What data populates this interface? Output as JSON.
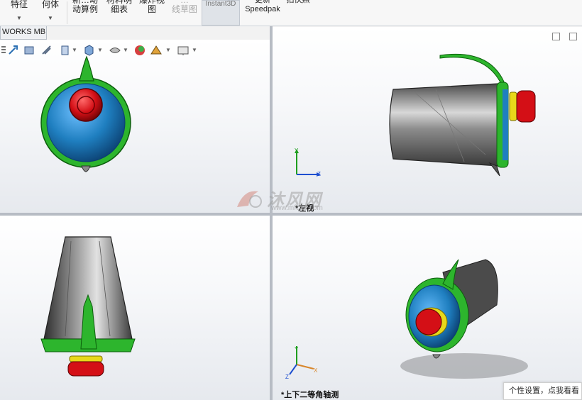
{
  "ribbon": {
    "buttons": [
      {
        "label": "特征",
        "has_arrow": true
      },
      {
        "label": "何体",
        "has_arrow": true
      },
      {
        "label": "新…动\n动算例",
        "has_arrow": false
      },
      {
        "label": "材料明\n细表",
        "has_arrow": false
      },
      {
        "label": "爆炸视\n图",
        "has_arrow": false
      },
      {
        "label": "…\n线草图",
        "has_arrow": false,
        "disabled": true
      },
      {
        "label": "Instant3D",
        "has_arrow": false,
        "active": true
      },
      {
        "label": "更新\nSpeedpak",
        "has_arrow": false
      },
      {
        "label": "拍快照",
        "has_arrow": false
      }
    ]
  },
  "tab": {
    "label": "WORKS MBD"
  },
  "viewports": {
    "top_right": {
      "label": ""
    },
    "bottom_right": {
      "label": "*上下二等角轴测"
    },
    "right_view_label": "*左视"
  },
  "triad_axes": {
    "x": "X",
    "y": "Y",
    "z": "Z"
  },
  "watermark": {
    "text": "沐风网",
    "url": "www.mfcad.com"
  },
  "tooltip": {
    "text": "个性设置，点我看看"
  },
  "colors": {
    "green": "#2db52d",
    "blue": "#1f7fc0",
    "red": "#d40f16",
    "yellow": "#e8d81a",
    "gray": "#6d6d6d"
  }
}
